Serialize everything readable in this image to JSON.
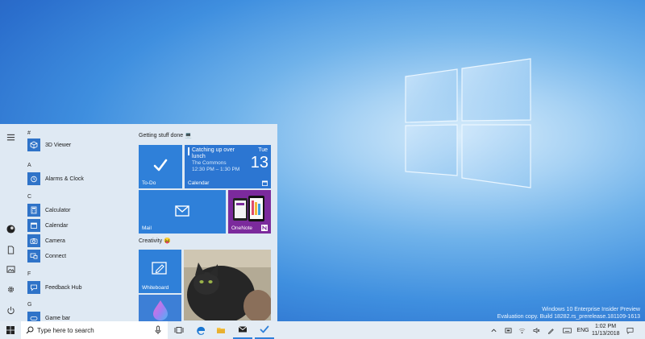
{
  "desktop": {
    "watermark_line1": "Windows 10 Enterprise Insider Preview",
    "watermark_line2": "Evaluation copy. Build 18282.rs_prerelease.181109-1613"
  },
  "start_menu": {
    "apps": [
      {
        "type": "letter",
        "text": "#"
      },
      {
        "type": "app",
        "label": "3D Viewer",
        "icon": "cube-icon"
      },
      {
        "type": "letter",
        "text": "A"
      },
      {
        "type": "app",
        "label": "Alarms & Clock",
        "icon": "alarm-clock-icon"
      },
      {
        "type": "letter",
        "text": "C"
      },
      {
        "type": "app",
        "label": "Calculator",
        "icon": "calculator-icon"
      },
      {
        "type": "app",
        "label": "Calendar",
        "icon": "calendar-icon"
      },
      {
        "type": "app",
        "label": "Camera",
        "icon": "camera-icon"
      },
      {
        "type": "app",
        "label": "Connect",
        "icon": "connect-icon"
      },
      {
        "type": "letter",
        "text": "F"
      },
      {
        "type": "app",
        "label": "Feedback Hub",
        "icon": "feedback-icon"
      },
      {
        "type": "letter",
        "text": "G"
      },
      {
        "type": "app",
        "label": "Game bar",
        "icon": "game-bar-icon"
      }
    ],
    "groups": {
      "g1_title": "Getting stuff done 💻",
      "g2_title": "Creativity 😝"
    },
    "tiles": {
      "todo_label": "To-Do",
      "calendar_label": "Calendar",
      "calendar_event_line1": "Catching up over",
      "calendar_event_line2": "lunch",
      "calendar_event_location": "The Commons",
      "calendar_event_time": "12:30 PM – 1:30 PM",
      "calendar_day": "Tue",
      "calendar_date": "13",
      "mail_label": "Mail",
      "onenote_label": "OneNote",
      "whiteboard_label": "Whiteboard"
    }
  },
  "taskbar": {
    "search_placeholder": "Type here to search",
    "language": "ENG",
    "time": "1:02 PM",
    "date": "11/13/2018"
  },
  "colors": {
    "accent": "#2f80d9",
    "tile_dark": "#2c6fc4",
    "onenote": "#7b2a9c",
    "taskbar": "#e4ecf4",
    "start_bg": "#dfe9f3"
  }
}
